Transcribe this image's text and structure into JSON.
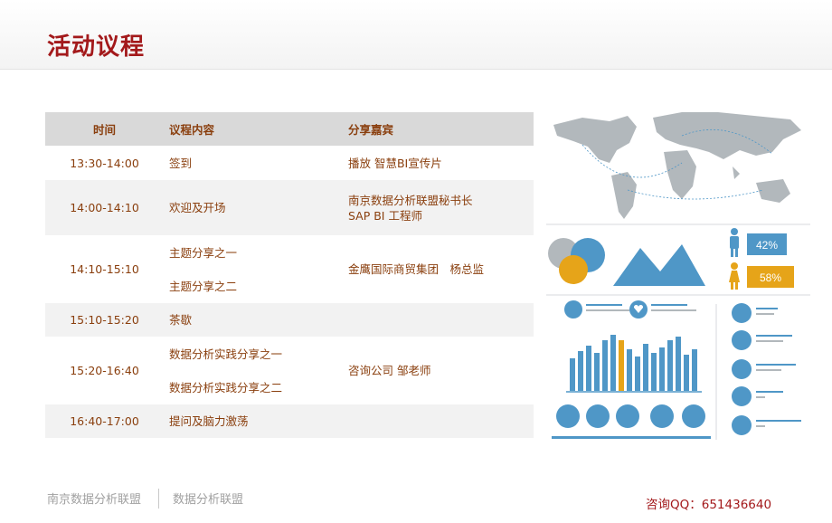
{
  "page": {
    "title": "活动议程",
    "accent_color": "#a3191b",
    "text_color": "#8a3f0e"
  },
  "agenda": {
    "headers": [
      "时间",
      "议程内容",
      "分享嘉宾"
    ],
    "rows": [
      {
        "time": "13:30-14:00",
        "items": [
          "签到"
        ],
        "speaker": [
          "播放 智慧BI宣传片"
        ]
      },
      {
        "time": "14:00-14:10",
        "items": [
          "欢迎及开场"
        ],
        "speaker": [
          "南京数据分析联盟秘书长",
          "SAP BI 工程师"
        ]
      },
      {
        "time": "14:10-15:10",
        "items": [
          "主题分享之一",
          "主题分享之二"
        ],
        "speaker": [
          "金鹰国际商贸集团　杨总监"
        ]
      },
      {
        "time": "15:10-15:20",
        "items": [
          "茶歇"
        ],
        "speaker": []
      },
      {
        "time": "15:20-16:40",
        "items": [
          "数据分析实践分享之一",
          "数据分析实践分享之二"
        ],
        "speaker": [
          "咨询公司 邹老师"
        ]
      },
      {
        "time": "16:40-17:00",
        "items": [
          "提问及脑力激荡"
        ],
        "speaker": []
      }
    ]
  },
  "infographic": {
    "gender": {
      "male_pct": "42%",
      "female_pct": "58%"
    },
    "icons": [
      "world-map",
      "male-icon",
      "female-icon",
      "heart-icon",
      "apple-icon",
      "sleep-icon"
    ],
    "colors": {
      "blue": "#4f97c7",
      "yellow": "#e6a419",
      "gray": "#b2b8bc"
    }
  },
  "footer": {
    "left": "南京数据分析联盟",
    "mid": "数据分析联盟",
    "contact": "咨询QQ：651436640"
  }
}
